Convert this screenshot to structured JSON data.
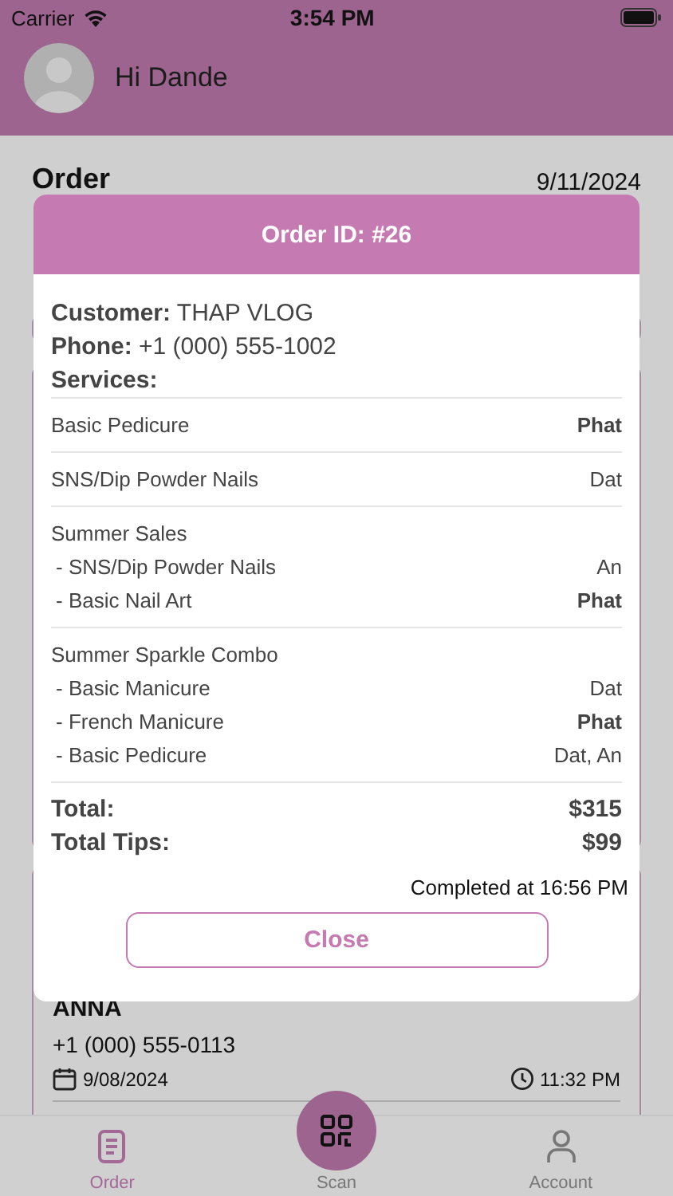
{
  "status_bar": {
    "carrier": "Carrier",
    "time": "3:54 PM"
  },
  "header": {
    "greeting": "Hi Dande"
  },
  "page": {
    "title": "Order",
    "date": "9/11/2024"
  },
  "background_order": {
    "customer": "ANNA",
    "phone": "+1 (000) 555-0113",
    "date": "9/08/2024",
    "time": "11:32 PM"
  },
  "modal": {
    "title": "Order ID: #26",
    "customer": "**Customer:** THAP VLOG",
    "phone": "**Phone:** +1 (000) 555-1002",
    "services_label": "Services:",
    "service_groups": [
      {
        "items": [
          {
            "name": "Basic Pedicure",
            "staff": "Phat",
            "highlighted": true
          }
        ]
      },
      {
        "items": [
          {
            "name": "SNS/Dip Powder Nails",
            "staff": "Dat",
            "highlighted": false
          }
        ]
      },
      {
        "title": "Summer Sales",
        "items": [
          {
            "name": "- SNS/Dip Powder Nails",
            "staff": "An",
            "highlighted": false
          },
          {
            "name": "- Basic Nail Art",
            "staff": "Phat",
            "highlighted": true
          }
        ]
      },
      {
        "title": "Summer Sparkle Combo",
        "items": [
          {
            "name": "- Basic Manicure",
            "staff": "Dat",
            "highlighted": false
          },
          {
            "name": "- French Manicure",
            "staff": "Phat",
            "highlighted": true
          },
          {
            "name": "- Basic Pedicure",
            "staff": "Dat, An",
            "highlighted": false
          }
        ]
      }
    ],
    "totals": [
      {
        "label": "Total:",
        "value": "$315"
      },
      {
        "label": "Total Tips:",
        "value": "$99"
      }
    ],
    "completed": "Completed at 16:56 PM",
    "close_button": "Close"
  },
  "tab_bar": [
    {
      "kind": "doc",
      "label": "Order",
      "selected": true
    },
    {
      "kind": "scan",
      "label": "Scan",
      "selected": false
    },
    {
      "kind": "person",
      "label": "Account",
      "selected": false
    }
  ]
}
